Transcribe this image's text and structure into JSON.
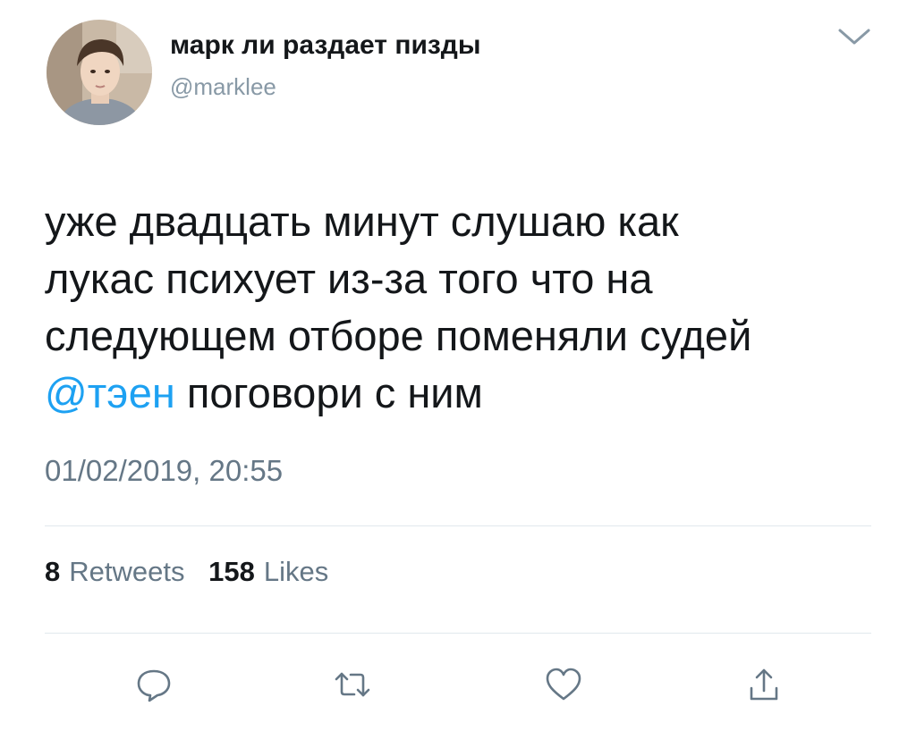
{
  "tweet": {
    "author": {
      "display_name": "марк ли раздает пизды",
      "handle": "@marklee",
      "avatar_icon": "avatar-photo"
    },
    "text": {
      "lines": [
        "уже двадцать минут слушаю как",
        "лукас психует из-за того что на",
        "следующем отборе поменяли судей"
      ],
      "last_line": {
        "mention": "@тэен",
        "rest": " поговори с ним"
      }
    },
    "timestamp": "01/02/2019, 20:55",
    "stats": {
      "retweets_count": "8",
      "retweets_label": "Retweets",
      "likes_count": "158",
      "likes_label": "Likes"
    },
    "actions": {
      "reply_icon": "reply-icon",
      "retweet_icon": "retweet-icon",
      "like_icon": "heart-icon",
      "share_icon": "share-icon"
    },
    "menu_icon": "chevron-down-icon"
  },
  "colors": {
    "text": "#14171a",
    "secondary": "#657786",
    "handle": "#8899a6",
    "link": "#1da1f2",
    "divider": "#e1e8ed",
    "icon": "#657786"
  }
}
